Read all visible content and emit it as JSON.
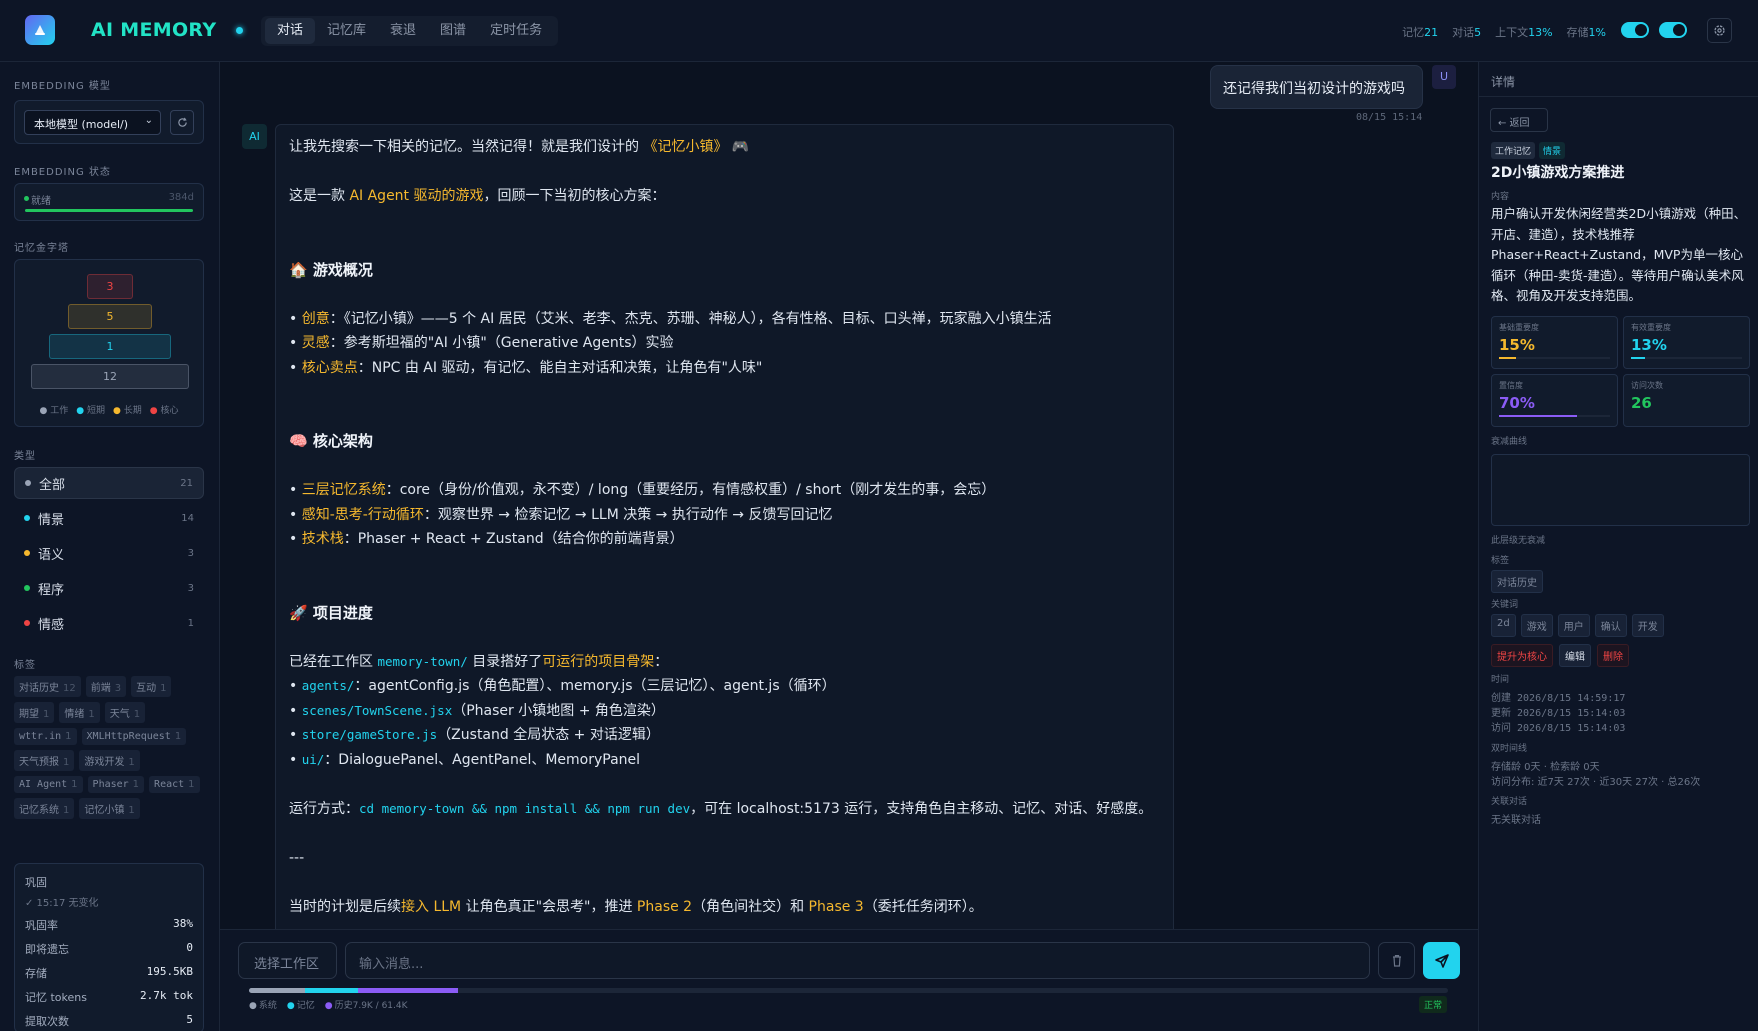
{
  "header": {
    "app_title": "AI MEMORY",
    "tabs": [
      "对话",
      "记忆库",
      "衰退",
      "图谱",
      "定时任务"
    ],
    "active_tab": 0,
    "stats": [
      {
        "label": "记忆",
        "value": "21"
      },
      {
        "label": "对话",
        "value": "5"
      },
      {
        "label": "上下文",
        "value": "13%"
      },
      {
        "label": "存储",
        "value": "1%"
      }
    ]
  },
  "sidebar": {
    "embedding_model_title": "EMBEDDING 模型",
    "embedding_model_value": "本地模型 (model/)",
    "embedding_status_title": "EMBEDDING 状态",
    "embedding_status_text": "就绪",
    "embedding_dim": "384d",
    "pyramid_title": "记忆金字塔",
    "pyramid": [
      {
        "label": "3",
        "color": "#ef4444"
      },
      {
        "label": "5",
        "color": "#f5b82e"
      },
      {
        "label": "1",
        "color": "#22d3ee"
      },
      {
        "label": "12",
        "color": "#9aa4b6"
      }
    ],
    "pyramid_legend": [
      {
        "label": "工作",
        "color": "#9aa4b6"
      },
      {
        "label": "短期",
        "color": "#22d3ee"
      },
      {
        "label": "长期",
        "color": "#f5b82e"
      },
      {
        "label": "核心",
        "color": "#ef4444"
      }
    ],
    "types_title": "类型",
    "types": [
      {
        "label": "全部",
        "count": "21",
        "color": "#9aa4b6"
      },
      {
        "label": "情景",
        "count": "14",
        "color": "#22d3ee"
      },
      {
        "label": "语义",
        "count": "3",
        "color": "#f5b82e"
      },
      {
        "label": "程序",
        "count": "3",
        "color": "#22c55e"
      },
      {
        "label": "情感",
        "count": "1",
        "color": "#ef4444"
      }
    ],
    "tags_title": "标签",
    "tags": [
      {
        "label": "对话历史",
        "count": "12"
      },
      {
        "label": "前端",
        "count": "3"
      },
      {
        "label": "互动",
        "count": "1"
      },
      {
        "label": "期望",
        "count": "1"
      },
      {
        "label": "情绪",
        "count": "1"
      },
      {
        "label": "天气",
        "count": "1"
      },
      {
        "label": "wttr.in",
        "count": "1"
      },
      {
        "label": "XMLHttpRequest",
        "count": "1"
      },
      {
        "label": "天气预报",
        "count": "1"
      },
      {
        "label": "游戏开发",
        "count": "1"
      },
      {
        "label": "AI Agent",
        "count": "1"
      },
      {
        "label": "Phaser",
        "count": "1"
      },
      {
        "label": "React",
        "count": "1"
      },
      {
        "label": "记忆系统",
        "count": "1"
      },
      {
        "label": "记忆小镇",
        "count": "1"
      }
    ],
    "consolidation": {
      "title": "巩固",
      "status": "✓ 15:17 无变化",
      "rows": [
        {
          "label": "巩固率",
          "value": "38%"
        },
        {
          "label": "即将遗忘",
          "value": "0"
        },
        {
          "label": "存储",
          "value": "195.5KB"
        },
        {
          "label": "记忆 tokens",
          "value": "2.7k tok"
        },
        {
          "label": "提取次数",
          "value": "5"
        }
      ]
    }
  },
  "chat": {
    "user_message": "还记得我们当初设计的游戏吗",
    "user_avatar": "U",
    "user_time": "08/15 15:14",
    "ai_avatar": "AI",
    "ai_message": [
      [
        {
          "t": "让我先搜索一下相关的记忆。当然记得！就是我们设计的 "
        },
        {
          "t": "《记忆小镇》",
          "s": "hl"
        },
        {
          "t": " 🎮"
        }
      ],
      [],
      [
        {
          "t": "这是一款 "
        },
        {
          "t": "AI Agent 驱动的游戏",
          "s": "hl"
        },
        {
          "t": "，回顾一下当初的核心方案："
        }
      ],
      [],
      [],
      [
        {
          "t": "🏠 游戏概况",
          "s": "h"
        }
      ],
      [],
      [
        {
          "t": "• "
        },
        {
          "t": "创意",
          "s": "hl"
        },
        {
          "t": "：《记忆小镇》——5 个 AI 居民（艾米、老李、杰克、苏珊、神秘人），各有性格、目标、口头禅，玩家融入小镇生活"
        }
      ],
      [
        {
          "t": "• "
        },
        {
          "t": "灵感",
          "s": "hl"
        },
        {
          "t": "：参考斯坦福的\"AI 小镇\"（Generative Agents）实验"
        }
      ],
      [
        {
          "t": "• "
        },
        {
          "t": "核心卖点",
          "s": "hl"
        },
        {
          "t": "：NPC 由 AI 驱动，有记忆、能自主对话和决策，让角色有\"人味\""
        }
      ],
      [],
      [],
      [
        {
          "t": "🧠 核心架构",
          "s": "h"
        }
      ],
      [],
      [
        {
          "t": "• "
        },
        {
          "t": "三层记忆系统",
          "s": "hl"
        },
        {
          "t": "：core（身份/价值观，永不变）/ long（重要经历，有情感权重）/ short（刚才发生的事，会忘）"
        }
      ],
      [
        {
          "t": "• "
        },
        {
          "t": "感知-思考-行动循环",
          "s": "hl"
        },
        {
          "t": "：观察世界 → 检索记忆 → LLM 决策 → 执行动作 → 反馈写回记忆"
        }
      ],
      [
        {
          "t": "• "
        },
        {
          "t": "技术栈",
          "s": "hl"
        },
        {
          "t": "：Phaser + React + Zustand（结合你的前端背景）"
        }
      ],
      [],
      [],
      [
        {
          "t": "🚀 项目进度",
          "s": "h"
        }
      ],
      [],
      [
        {
          "t": "已经在工作区 "
        },
        {
          "t": "memory-town/",
          "s": "code"
        },
        {
          "t": " 目录搭好了"
        },
        {
          "t": "可运行的项目骨架",
          "s": "hl"
        },
        {
          "t": "："
        }
      ],
      [
        {
          "t": "• "
        },
        {
          "t": "agents/",
          "s": "code"
        },
        {
          "t": "：agentConfig.js（角色配置）、memory.js（三层记忆）、agent.js（循环）"
        }
      ],
      [
        {
          "t": "• "
        },
        {
          "t": "scenes/TownScene.jsx",
          "s": "code"
        },
        {
          "t": "（Phaser 小镇地图 + 角色渲染）"
        }
      ],
      [
        {
          "t": "• "
        },
        {
          "t": "store/gameStore.js",
          "s": "code"
        },
        {
          "t": "（Zustand 全局状态 + 对话逻辑）"
        }
      ],
      [
        {
          "t": "• "
        },
        {
          "t": "ui/",
          "s": "code"
        },
        {
          "t": "：DialoguePanel、AgentPanel、MemoryPanel"
        }
      ],
      [],
      [
        {
          "t": "运行方式："
        },
        {
          "t": "cd memory-town && npm install && npm run dev",
          "s": "code"
        },
        {
          "t": "，可在 localhost:5173 运行，支持角色自主移动、记忆、对话、好感度。"
        }
      ],
      [],
      [
        {
          "t": "---"
        }
      ],
      [],
      [
        {
          "t": "当时的计划是后续"
        },
        {
          "t": "接入 LLM",
          "s": "hl"
        },
        {
          "t": " 让角色真正\"会思考\"，推进 "
        },
        {
          "t": "Phase 2",
          "s": "hl"
        },
        {
          "t": "（角色间社交）和 "
        },
        {
          "t": "Phase 3",
          "s": "hl"
        },
        {
          "t": "（委托任务闭环）。"
        }
      ]
    ]
  },
  "composer": {
    "workspace_placeholder": "选择工作区",
    "input_placeholder": "输入消息...",
    "context_segments": [
      {
        "name": "系统",
        "fraction": 0.047,
        "color": "#9aa4b6"
      },
      {
        "name": "记忆",
        "fraction": 0.044,
        "color": "#22d3ee"
      },
      {
        "name": "历史",
        "fraction": 0.083,
        "color": "#8b5cf6"
      }
    ],
    "legend": [
      "系统",
      "记忆",
      "历史7.9K / 61.4K"
    ],
    "status": "正常"
  },
  "detail": {
    "panel_title": "详情",
    "back_label": "← 返回",
    "badges": [
      "工作记忆",
      "情景"
    ],
    "title": "2D小镇游戏方案推进",
    "content_label": "内容",
    "content": "用户确认开发休闲经营类2D小镇游戏（种田、开店、建造），技术栈推荐Phaser+React+Zustand，MVP为单一核心循环（种田-卖货-建造）。等待用户确认美术风格、视角及开发支持范围。",
    "metrics": [
      {
        "label": "基础重要度",
        "value": "15%",
        "fraction": 0.15,
        "color": "#f5b82e"
      },
      {
        "label": "有效重要度",
        "value": "13%",
        "fraction": 0.13,
        "color": "#22d3ee"
      },
      {
        "label": "置信度",
        "value": "70%",
        "fraction": 0.7,
        "color": "#8b5cf6"
      },
      {
        "label": "访问次数",
        "value": "26",
        "fraction": 0,
        "color": "#22c55e"
      }
    ],
    "decay_label": "衰减曲线",
    "decay_note": "此层级无衰减",
    "tags_label": "标签",
    "tags": [
      "对话历史"
    ],
    "keywords_label": "关键词",
    "keywords": [
      "2d",
      "游戏",
      "用户",
      "确认",
      "开发"
    ],
    "actions": [
      {
        "label": "提升为核心",
        "color": "#ef4444"
      },
      {
        "label": "编辑",
        "color": "#d6dde8"
      },
      {
        "label": "删除",
        "color": "#ef4444"
      }
    ],
    "time_label": "时间",
    "times": [
      "创建 2026/8/15 14:59:17",
      "更新 2026/8/15 15:14:03",
      "访问 2026/8/15 15:14:03"
    ],
    "dual_time_label": "双时间线",
    "dual_time_1": "存储龄 0天 · 检索龄 0天",
    "dual_time_2": "访问分布: 近7天 27次 · 近30天 27次 · 总26次",
    "related_label": "关联对话",
    "related_value": "无关联对话"
  }
}
